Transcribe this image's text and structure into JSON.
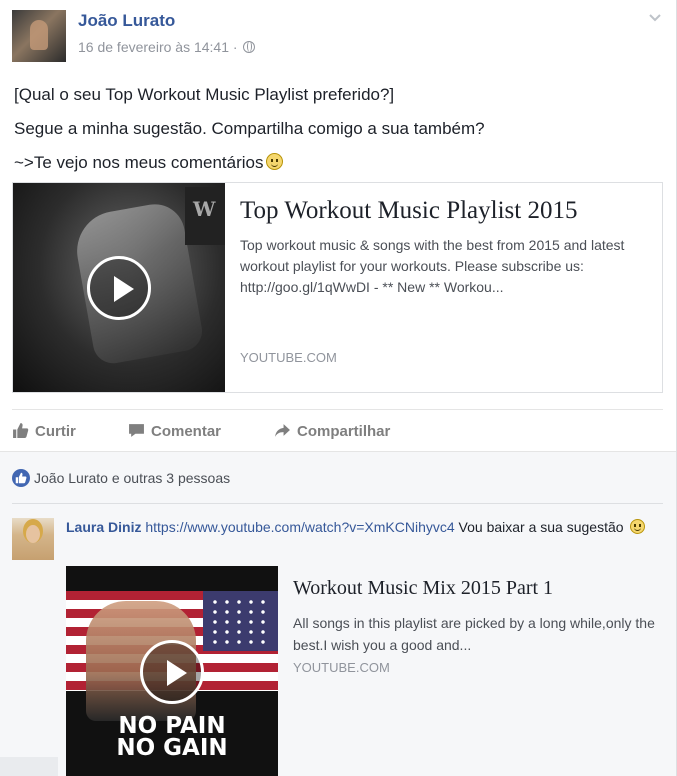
{
  "post": {
    "author": "João Lurato",
    "timestamp": "16 de fevereiro às 14:41",
    "separator": " · ",
    "privacy_icon": "globe-icon",
    "lines": [
      "[Qual o seu Top Workout Music Playlist preferido?]",
      "Segue a minha sugestão. Compartilha comigo a sua também?",
      "~>Te vejo nos meus comentários"
    ]
  },
  "link_card": {
    "title": "Top Workout Music Playlist 2015",
    "description": "Top workout music & songs with the best from 2015 and latest workout playlist for your workouts. Please subscribe us: http://goo.gl/1qWwDI - ** New ** Workou...",
    "source": "YOUTUBE.COM",
    "thumb_logo": "W"
  },
  "actions": {
    "like": "Curtir",
    "comment": "Comentar",
    "share": "Compartilhar"
  },
  "feedback": {
    "likes_text": "João Lurato e outras 3 pessoas"
  },
  "comment": {
    "author": "Laura Diniz",
    "link": "https://www.youtube.com/watch?v=XmKCNihyvc4",
    "text": " Vou baixar a sua sugestão",
    "card": {
      "title": "Workout Music Mix 2015 Part 1",
      "description": "All songs in this playlist are picked by a long while,only the best.I wish you a good and...",
      "source": "YOUTUBE.COM",
      "slogan_line1": "NO PAIN",
      "slogan_line2": "NO GAIN"
    }
  },
  "colors": {
    "link_blue": "#365899",
    "like_blue": "#4267b2",
    "muted": "#90949c",
    "feedback_bg": "#f6f7f9"
  }
}
